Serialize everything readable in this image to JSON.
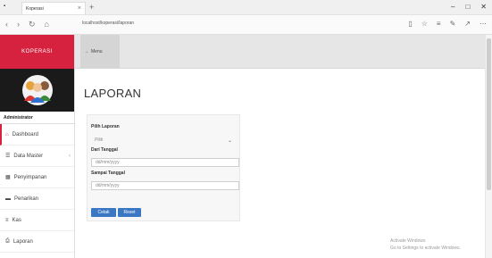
{
  "browser": {
    "tab_title": "Koperasi",
    "url": "localhost/koperasi/laporan",
    "new_tab_symbol": "+",
    "tab_close_symbol": "×",
    "window_controls": [
      "–",
      "□",
      "✕"
    ]
  },
  "sidebar": {
    "brand": "KOPERASI",
    "admin_label": "Administrator",
    "items": [
      {
        "label": "Dashboard",
        "icon": "home-icon",
        "active": true
      },
      {
        "label": "Data Master",
        "icon": "list-icon",
        "has_children": true
      },
      {
        "label": "Penyimpanan",
        "icon": "table-icon"
      },
      {
        "label": "Penarikan",
        "icon": "card-icon"
      },
      {
        "label": "Kas",
        "icon": "menu-icon"
      },
      {
        "label": "Laporan",
        "icon": "report-icon"
      }
    ]
  },
  "topnav": {
    "breadcrumb_label": "Menu"
  },
  "page": {
    "title": "LAPORAN"
  },
  "form": {
    "label_pilih": "Pilih Laporan",
    "select_value": "Pilih",
    "label_dari": "Dari Tanggal",
    "dari_placeholder": "dd/mm/yyyy",
    "label_sampai": "Sampai Tanggal",
    "sampai_placeholder": "dd/mm/yyyy",
    "btn_cetak": "Cetak",
    "btn_reset": "Reset"
  },
  "watermark": {
    "line1": "Activate Windows",
    "line2": "Go to Settings to activate Windows."
  },
  "colors": {
    "brand_red": "#d6223f",
    "button_blue": "#3b78c3"
  }
}
